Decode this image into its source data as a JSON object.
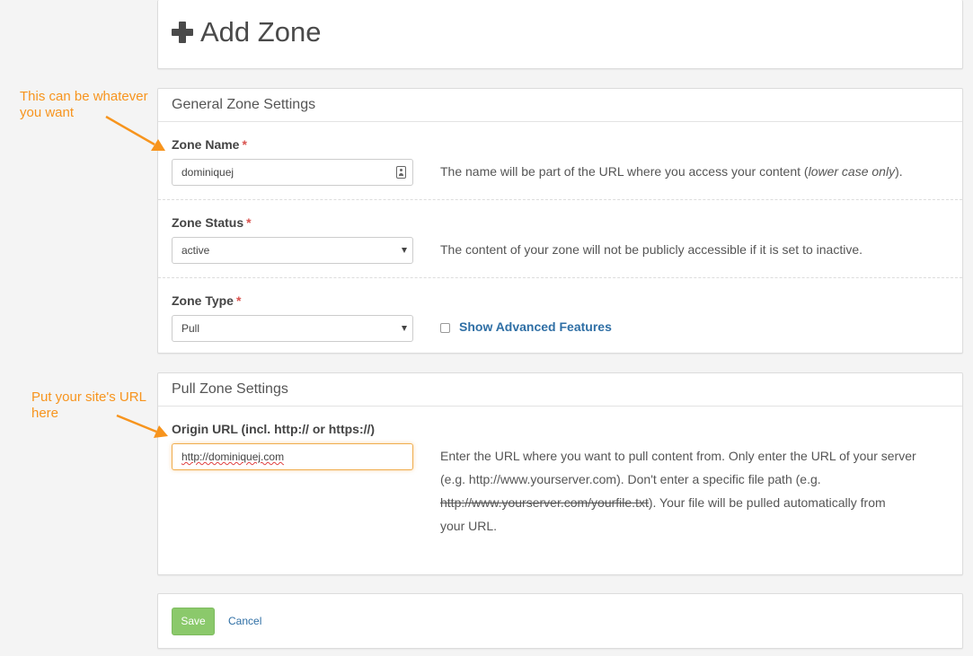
{
  "header": {
    "title": "Add Zone"
  },
  "general": {
    "heading": "General Zone Settings",
    "zone_name": {
      "label": "Zone Name",
      "required_marker": "*",
      "value": "dominiquej",
      "help_before": "The name will be part of the URL where you access your content (",
      "help_em": "lower case only",
      "help_after": ")."
    },
    "zone_status": {
      "label": "Zone Status",
      "required_marker": "*",
      "selected": "active",
      "help": "The content of your zone will not be publicly accessible if it is set to inactive."
    },
    "zone_type": {
      "label": "Zone Type",
      "required_marker": "*",
      "selected": "Pull",
      "advanced_label": "Show Advanced Features",
      "advanced_checked": false
    }
  },
  "pull": {
    "heading": "Pull Zone Settings",
    "origin": {
      "label": "Origin URL (incl. http:// or https://)",
      "value": "http://dominiquej.com",
      "help_line1": "Enter the URL where you want to pull content from. Only enter the URL of your server",
      "help_line2": "(e.g. http://www.yourserver.com). Don't enter a specific file path (e.g.",
      "help_line3_strike": "http://www.yourserver.com/yourfile.txt",
      "help_line3_rest": "). Your file will be pulled automatically from",
      "help_line4": "your URL."
    }
  },
  "actions": {
    "save_label": "Save",
    "cancel_label": "Cancel"
  },
  "annotations": {
    "zone_name_note_line1": "This can be whatever",
    "zone_name_note_line2": "you want",
    "origin_note_line1": "Put your site's URL",
    "origin_note_line2": "here"
  },
  "colors": {
    "annotation": "#f7941d",
    "save_button": "#8bc96b",
    "link": "#2f6fa5",
    "required": "#d9534f"
  }
}
